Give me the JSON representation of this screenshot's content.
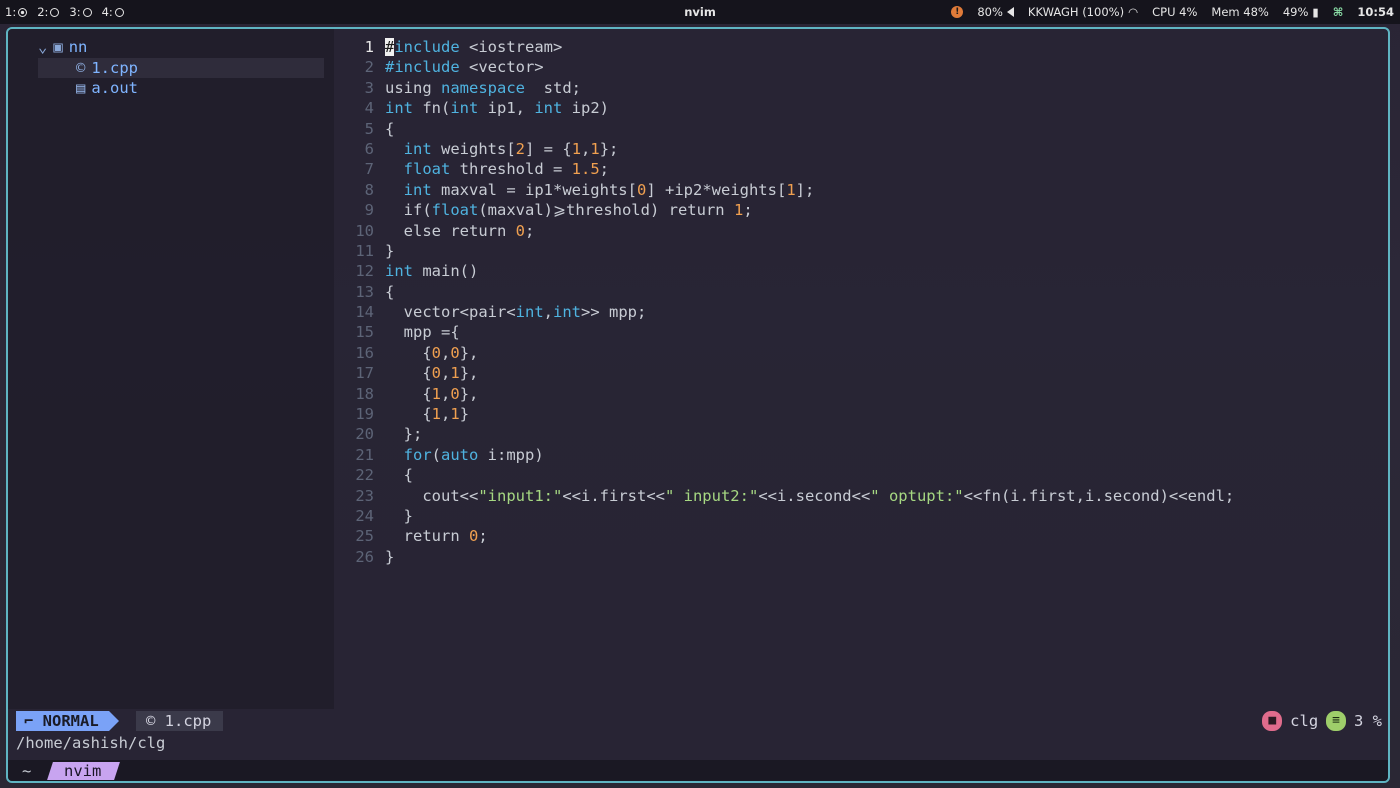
{
  "topbar": {
    "workspaces": [
      {
        "label": "1:",
        "active": true
      },
      {
        "label": "2:",
        "active": false
      },
      {
        "label": "3:",
        "active": false
      },
      {
        "label": "4:",
        "active": false
      }
    ],
    "window_title": "nvim",
    "volume": "80%",
    "wifi": "KKWAGH (100%)",
    "cpu": "CPU  4%",
    "mem": "Mem 48%",
    "battery": "49%",
    "clock": "10:54"
  },
  "file_tree": {
    "root": "nn",
    "items": [
      {
        "name": "1.cpp",
        "icon": "c-file-icon"
      },
      {
        "name": "a.out",
        "icon": "binary-file-icon"
      }
    ]
  },
  "editor": {
    "current_line": 1,
    "lines": [
      "#include <iostream>",
      "#include <vector>",
      "using namespace  std;",
      "int fn(int ip1, int ip2)",
      "{",
      "  int weights[2] = {1,1};",
      "  float threshold = 1.5;",
      "  int maxval = ip1*weights[0] +ip2*weights[1];",
      "  if(float(maxval)⩾threshold) return 1;",
      "  else return 0;",
      "}",
      "int main()",
      "{",
      "  vector<pair<int,int>> mpp;",
      "  mpp ={",
      "    {0,0},",
      "    {0,1},",
      "    {1,0},",
      "    {1,1}",
      "  };",
      "  for(auto i:mpp)",
      "  {",
      "    cout<<\"input1:\"<<i.first<<\" input2:\"<<i.second<<\" optupt:\"<<fn(i.first,i.second)<<endl;",
      "  }",
      "  return 0;",
      "}"
    ]
  },
  "statusline": {
    "mode": "NORMAL",
    "file": "1.cpp",
    "folder": "clg",
    "position": "3 %"
  },
  "cwd": "/home/ashish/clg",
  "tmux": {
    "home": "~",
    "window": "nvim"
  },
  "colors": {
    "accent": "#5fb4c2",
    "mode_bg": "#7aa2f7",
    "keyword": "#4fb3e0",
    "number": "#f0a050",
    "string": "#a6d882"
  }
}
